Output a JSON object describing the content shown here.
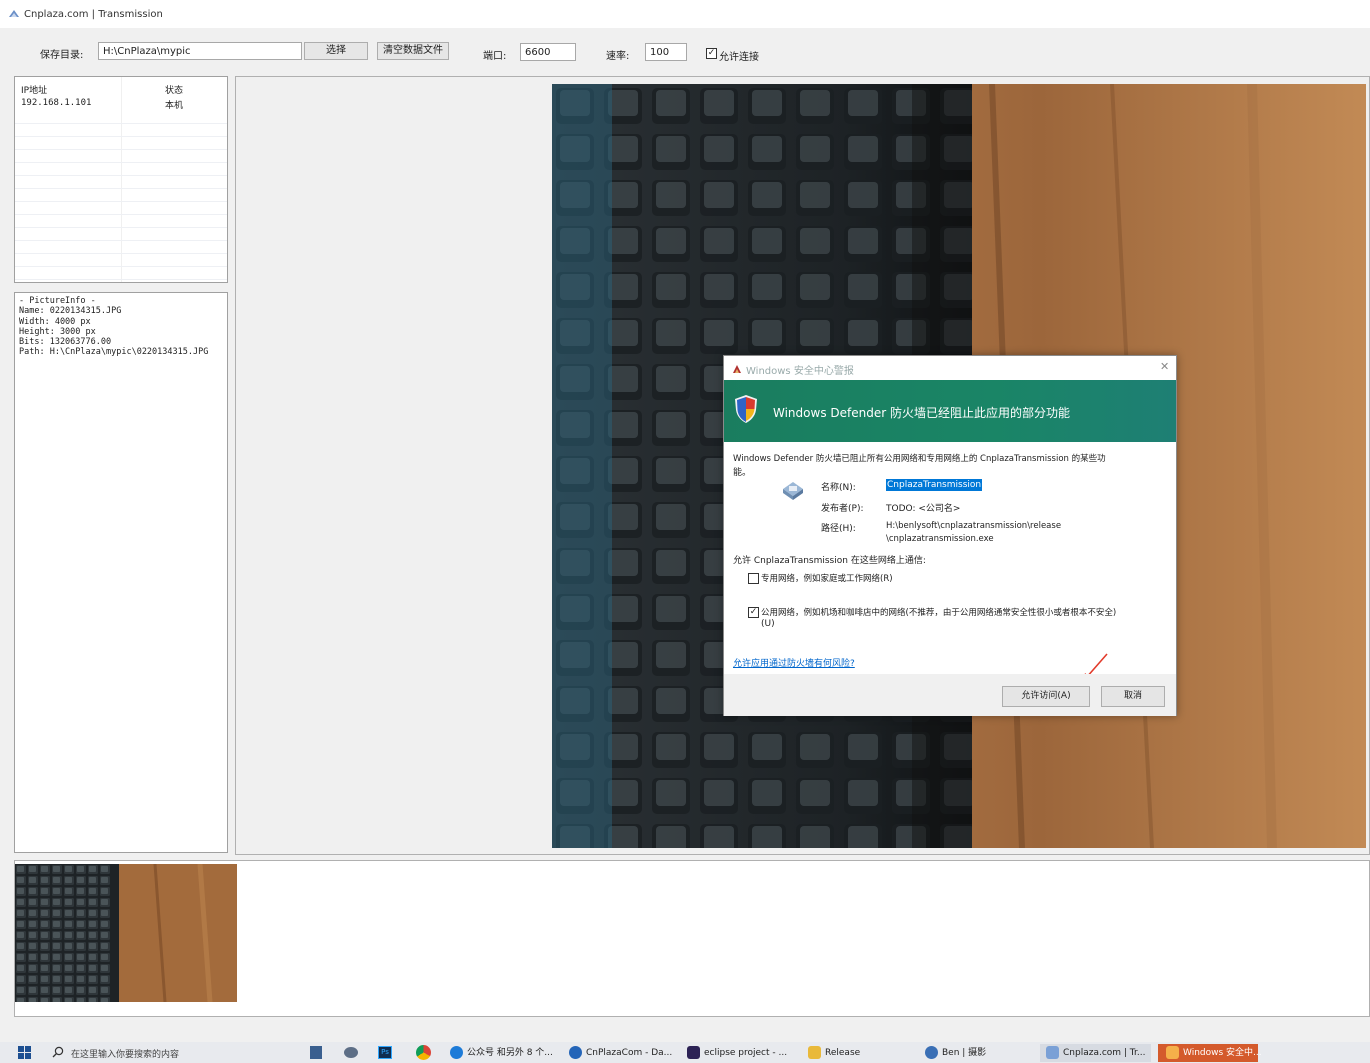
{
  "window": {
    "title": "Cnplaza.com | Transmission"
  },
  "toolbar": {
    "save_dir_label": "保存目录:",
    "save_dir_value": "H:\\CnPlaza\\mypic",
    "select_button": "选择",
    "clear_button": "清空数据文件",
    "port_label": "端口:",
    "port_value": "6600",
    "speed_label": "速率:",
    "speed_value": "100",
    "allow_label": "允许连接",
    "allow_checked": true
  },
  "ip_table": {
    "headers": [
      "IP地址",
      "状态"
    ],
    "rows": [
      [
        "192.168.1.101",
        "本机"
      ]
    ]
  },
  "picture_info": {
    "lines": [
      "- PictureInfo -",
      "Name: 0220134315.JPG",
      "Width: 4000 px",
      "Height: 3000 px",
      "Bits: 132063776.00",
      "Path: H:\\CnPlaza\\mypic\\0220134315.JPG"
    ]
  },
  "dialog": {
    "title": "Windows 安全中心警报",
    "header": "Windows Defender 防火墙已经阻止此应用的部分功能",
    "message_line1": "Windows Defender 防火墙已阻止所有公用网络和专用网络上的 CnplazaTransmission 的某些功",
    "message_line2": "能。",
    "name_label": "名称(N):",
    "name_value": "CnplazaTransmission",
    "publisher_label": "发布者(P):",
    "publisher_value": "TODO: <公司名>",
    "path_label": "路径(H):",
    "path_value_1": "H:\\benlysoft\\cnplazatransmission\\release",
    "path_value_2": "\\cnplazatransmission.exe",
    "allow_prompt": "允许 CnplazaTransmission 在这些网络上通信:",
    "private_label": "专用网络，例如家庭或工作网络(R)",
    "private_checked": false,
    "public_label": "公用网络，例如机场和咖啡店中的网络(不推荐，由于公用网络通常安全性很小或者根本不安全)",
    "public_label_2": "(U)",
    "public_checked": true,
    "risk_link": "允许应用通过防火墙有何风险?",
    "allow_button": "允许访问(A)",
    "cancel_button": "取消"
  },
  "taskbar": {
    "search_placeholder": "在这里输入你要搜索的内容",
    "items": [
      "公众号 和另外 8 个...",
      "CnPlazaCom - Da...",
      "eclipse project - ...",
      "Release",
      "Ben | 摄影",
      "Cnplaza.com | Tr...",
      "Windows 安全中..."
    ]
  },
  "colors": {
    "dialog_header": "#1a7d5f",
    "link": "#0066cc",
    "selection": "#0078d7"
  }
}
